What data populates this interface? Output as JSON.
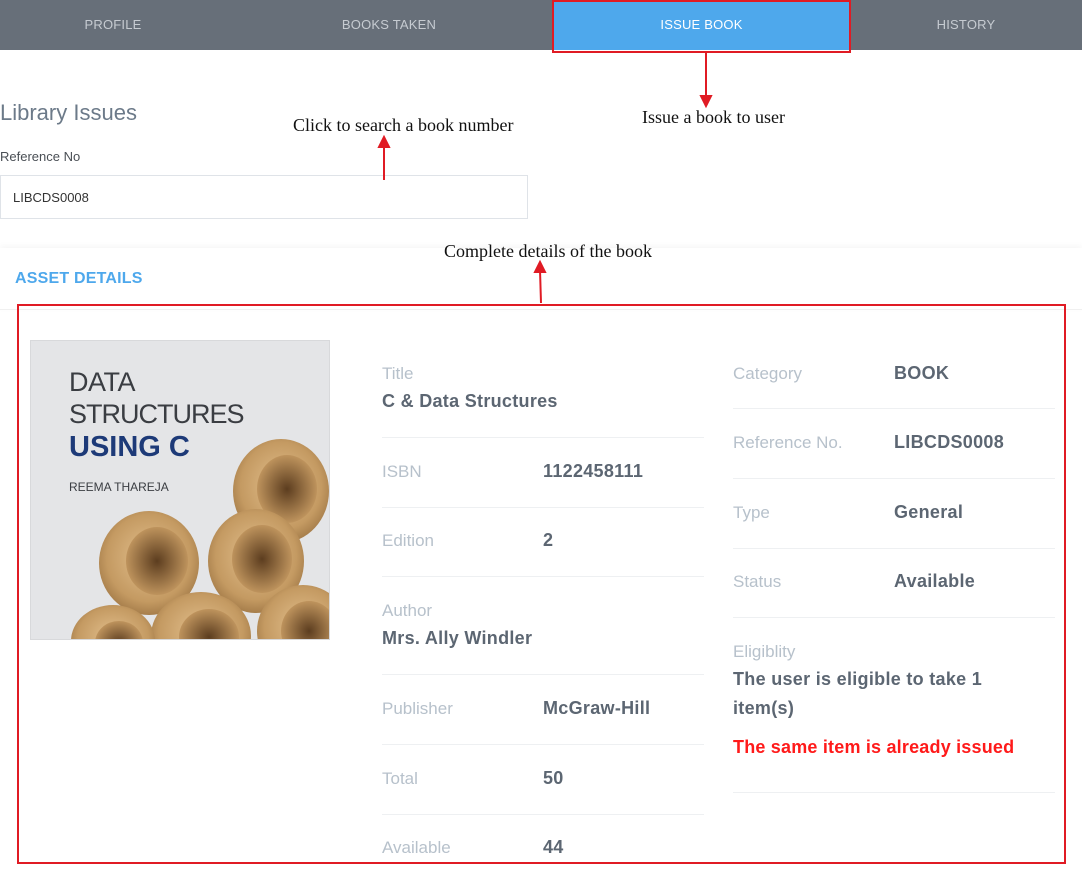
{
  "tabs": {
    "profile": "PROFILE",
    "books_taken": "BOOKS TAKEN",
    "issue_book": "ISSUE BOOK",
    "history": "HISTORY"
  },
  "page": {
    "title": "Library Issues",
    "reference_label": "Reference No",
    "reference_value": "LIBCDS0008"
  },
  "asset_details": {
    "heading": "ASSET DETAILS",
    "cover": {
      "line1": "DATA",
      "line2": "STRUCTURES",
      "line3": "USING C",
      "author": "REEMA THAREJA"
    },
    "title_label": "Title",
    "title_value": "C & Data Structures",
    "isbn_label": "ISBN",
    "isbn_value": "1122458111",
    "edition_label": "Edition",
    "edition_value": "2",
    "author_label": "Author",
    "author_value": "Mrs. Ally Windler",
    "publisher_label": "Publisher",
    "publisher_value": "McGraw-Hill",
    "total_label": "Total",
    "total_value": "50",
    "available_label": "Available",
    "available_value": "44",
    "category_label": "Category",
    "category_value": "BOOK",
    "refno_label": "Reference No.",
    "refno_value": "LIBCDS0008",
    "type_label": "Type",
    "type_value": "General",
    "status_label": "Status",
    "status_value": "Available",
    "eligibility_label": "Eligiblity",
    "eligibility_line1": "The user is eligible to take 1",
    "eligibility_line2": "item(s)",
    "warning": "The same item is already issued"
  },
  "annotations": {
    "search": "Click to search a book number",
    "issue": "Issue a book to user",
    "details": "Complete details of the book"
  },
  "colors": {
    "nav_bg": "#676f79",
    "active_tab": "#4ea8ec",
    "accent": "#4ea8ec",
    "warning": "#ff1a1a",
    "annotation": "#e01b24"
  }
}
